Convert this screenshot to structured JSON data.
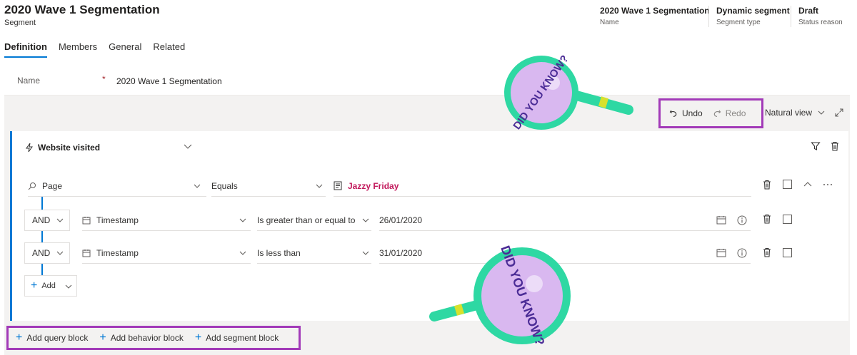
{
  "header": {
    "title": "2020 Wave 1 Segmentation",
    "subtitle": "Segment",
    "fields": [
      {
        "value": "2020 Wave 1 Segmentation",
        "label": "Name"
      },
      {
        "value": "Dynamic segment",
        "label": "Segment type"
      },
      {
        "value": "Draft",
        "label": "Status reason"
      }
    ]
  },
  "tabs": [
    "Definition",
    "Members",
    "General",
    "Related"
  ],
  "name_field": {
    "label": "Name",
    "required_marker": "*",
    "value": "2020 Wave 1 Segmentation"
  },
  "toolbar": {
    "undo": "Undo",
    "redo": "Redo",
    "view": "Natural view"
  },
  "block": {
    "title": "Website visited",
    "rows": [
      {
        "field": "Page",
        "operator": "Equals",
        "value": "Jazzy Friday"
      },
      {
        "connector": "AND",
        "field": "Timestamp",
        "operator": "Is greater than or equal to",
        "value": "26/01/2020"
      },
      {
        "connector": "AND",
        "field": "Timestamp",
        "operator": "Is less than",
        "value": "31/01/2020"
      }
    ],
    "add_label": "Add"
  },
  "add_bar": {
    "query": "Add query block",
    "behavior": "Add behavior block",
    "segment": "Add segment block"
  },
  "callout": {
    "text": "DID YOU KNOW?"
  },
  "colors": {
    "accent": "#0078d4",
    "highlight": "#a23ab8",
    "callout_ring": "#2ed8a3",
    "callout_fill": "#d9b8f0",
    "value_pink": "#c2185b"
  }
}
